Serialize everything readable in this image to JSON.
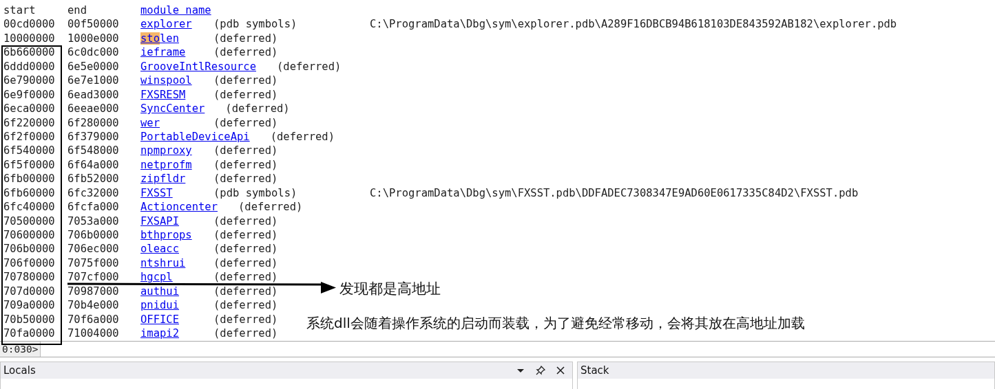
{
  "module_list": {
    "header": {
      "start": "start",
      "end": "end",
      "name": "module name"
    },
    "rows": [
      {
        "start": "00cd0000",
        "end": "00f50000",
        "name": "explorer",
        "status": "(pdb symbols)",
        "path": "C:\\ProgramData\\Dbg\\sym\\explorer.pdb\\A289F16DBCB94B618103DE843592AB182\\explorer.pdb"
      },
      {
        "start": "10000000",
        "end": "1000e000",
        "name_parts": [
          {
            "text": "sto",
            "highlighted": true
          },
          {
            "text": "len",
            "highlighted": false
          }
        ],
        "status": "(deferred)"
      },
      {
        "start": "6b660000",
        "end": "6c0dc000",
        "name": "ieframe",
        "status": "(deferred)"
      },
      {
        "start": "6ddd0000",
        "end": "6e5e0000",
        "name": "GrooveIntlResource",
        "status": "(deferred)"
      },
      {
        "start": "6e790000",
        "end": "6e7e1000",
        "name": "winspool",
        "status": "(deferred)"
      },
      {
        "start": "6e9f0000",
        "end": "6ead3000",
        "name": "FXSRESM",
        "status": "(deferred)"
      },
      {
        "start": "6eca0000",
        "end": "6eeae000",
        "name": "SyncCenter",
        "status": "(deferred)"
      },
      {
        "start": "6f220000",
        "end": "6f280000",
        "name": "wer",
        "status": "(deferred)"
      },
      {
        "start": "6f2f0000",
        "end": "6f379000",
        "name": "PortableDeviceApi",
        "status": "(deferred)"
      },
      {
        "start": "6f540000",
        "end": "6f548000",
        "name": "npmproxy",
        "status": "(deferred)"
      },
      {
        "start": "6f5f0000",
        "end": "6f64a000",
        "name": "netprofm",
        "status": "(deferred)"
      },
      {
        "start": "6fb00000",
        "end": "6fb52000",
        "name": "zipfldr",
        "status": "(deferred)"
      },
      {
        "start": "6fb60000",
        "end": "6fc32000",
        "name": "FXSST",
        "status": "(pdb symbols)",
        "path": "C:\\ProgramData\\Dbg\\sym\\FXSST.pdb\\DDFADEC7308347E9AD60E0617335C84D2\\FXSST.pdb"
      },
      {
        "start": "6fc40000",
        "end": "6fcfa000",
        "name": "Actioncenter",
        "status": "(deferred)"
      },
      {
        "start": "70500000",
        "end": "7053a000",
        "name": "FXSAPI",
        "status": "(deferred)"
      },
      {
        "start": "70600000",
        "end": "706b0000",
        "name": "bthprops",
        "status": "(deferred)"
      },
      {
        "start": "706b0000",
        "end": "706ec000",
        "name": "oleacc",
        "status": "(deferred)"
      },
      {
        "start": "706f0000",
        "end": "7075f000",
        "name": "ntshrui",
        "status": "(deferred)"
      },
      {
        "start": "70780000",
        "end": "707cf000",
        "name": "hgcpl",
        "status": "(deferred)"
      },
      {
        "start": "707d0000",
        "end": "70987000",
        "name": "authui",
        "status": "(deferred)"
      },
      {
        "start": "709a0000",
        "end": "70b4e000",
        "name": "pnidui",
        "status": "(deferred)"
      },
      {
        "start": "70b50000",
        "end": "70f6a000",
        "name": "OFFICE",
        "status": "(deferred)"
      },
      {
        "start": "70fa0000",
        "end": "71004000",
        "name": "imapi2",
        "status": "(deferred)"
      }
    ]
  },
  "annotations": {
    "arrow_label": "发现都是高地址",
    "note": "系统dll会随着操作系统的启动而装载，为了避免经常移动，会将其放在高地址加载"
  },
  "command": {
    "prompt": "0:030>"
  },
  "panels": [
    {
      "title": "Locals",
      "controls": true
    },
    {
      "title": "Stack",
      "controls": false
    }
  ]
}
